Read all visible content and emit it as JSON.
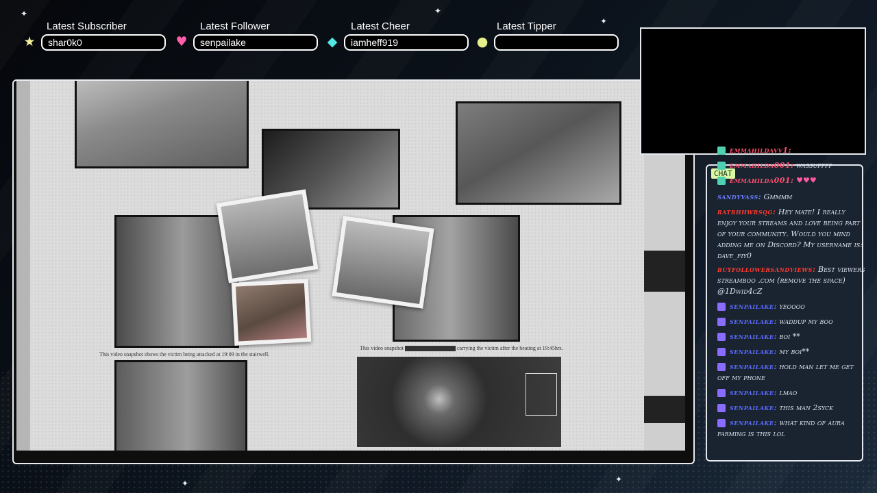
{
  "stats": [
    {
      "label": "Latest Subscriber",
      "value": "shar0k0",
      "icon": "star-icon",
      "color": "#f3ef9a"
    },
    {
      "label": "Latest Follower",
      "value": "senpailake",
      "icon": "heart-icon",
      "color": "#ff5ea8"
    },
    {
      "label": "Latest Cheer",
      "value": "iamheff919",
      "icon": "diamond-icon",
      "color": "#53e6e3"
    },
    {
      "label": "Latest Tipper",
      "value": "",
      "icon": "coin-icon",
      "color": "#e6f08a"
    }
  ],
  "evidence": {
    "caption_left": "This video snapshot shows the victim being attacked at 19:09 in the stairwell.",
    "caption_right_a": "This video snapshot",
    "caption_right_b": "carrying the victim after the beating at 19:45hrs."
  },
  "chat": {
    "tag": "CHAT",
    "messages": [
      {
        "name": "emmahildavv1:",
        "text": "",
        "badge": "emma",
        "name_color": "#ff4f6e"
      },
      {
        "name": "emmahilda001:",
        "text": "wassupppp",
        "badge": "emma",
        "name_color": "#ff4f6e"
      },
      {
        "name": "emmahilda001:",
        "text": "♥♥♥",
        "badge": "emma",
        "name_color": "#ff4f6e"
      },
      {
        "name": "sandyvass:",
        "text": "Gmmmm",
        "badge": "",
        "name_color": "#6a7dff"
      },
      {
        "name": "ratrhhwrsqg:",
        "text": "Hey mate! I really enjoy your streams and love being part of your community. Would you mind adding me on Discord? My username is: dave_fiy0",
        "badge": "",
        "name_color": "#ff3b2f"
      },
      {
        "name": "buyfollowersandviews:",
        "text": "Best viewers streamboo .com (remove the space) @1Dwid4cZ",
        "badge": "",
        "name_color": "#ff3b2f"
      },
      {
        "name": "senpailake:",
        "text": "yeoooo",
        "badge": "sub",
        "name_color": "#5c6bff"
      },
      {
        "name": "senpailake:",
        "text": "waddup my boo",
        "badge": "sub",
        "name_color": "#5c6bff"
      },
      {
        "name": "senpailake:",
        "text": "boi **",
        "badge": "sub",
        "name_color": "#5c6bff"
      },
      {
        "name": "senpailake:",
        "text": "my boi**",
        "badge": "sub",
        "name_color": "#5c6bff"
      },
      {
        "name": "senpailake:",
        "text": "hold man let me get off my phone",
        "badge": "sub",
        "name_color": "#5c6bff"
      },
      {
        "name": "senpailake:",
        "text": "lmao",
        "badge": "sub",
        "name_color": "#5c6bff"
      },
      {
        "name": "senpailake:",
        "text": "this man 2syck",
        "badge": "sub",
        "name_color": "#5c6bff"
      },
      {
        "name": "senpailake:",
        "text": "what kind of aura farming is this lol",
        "badge": "sub",
        "name_color": "#5c6bff"
      }
    ]
  }
}
